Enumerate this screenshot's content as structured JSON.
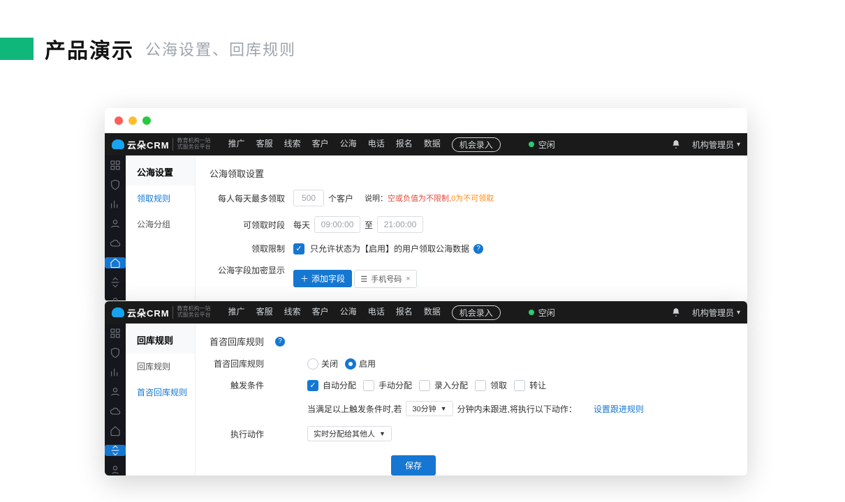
{
  "title": {
    "main": "产品演示",
    "sub": "公海设置、回库规则"
  },
  "topnav": [
    "推广",
    "客服",
    "线索",
    "客户",
    "公海",
    "电话",
    "报名",
    "数据"
  ],
  "topnav_pill": "机会录入",
  "status_text": "空闲",
  "user_name": "机构管理员",
  "logo_text": "云朵CRM",
  "logo_sub": "教育机构一站式服务云平台",
  "win1": {
    "side_title": "公海设置",
    "side_items": [
      "领取规则",
      "公海分组"
    ],
    "content_title": "公海领取设置",
    "row1": {
      "label": "每人每天最多领取",
      "value": "500",
      "unit": "个客户",
      "note_prefix": "说明：",
      "note_red": "空或负值为不限制,",
      "note_orange": "0为不可领取"
    },
    "row2": {
      "label": "可领取时段",
      "prefix": "每天",
      "from": "09:00:00",
      "to_label": "至",
      "to": "21:00:00"
    },
    "row3": {
      "label": "领取限制",
      "text": "只允许状态为【启用】的用户领取公海数据"
    },
    "row4": {
      "label": "公海字段加密显示",
      "btn": "添加字段",
      "tag": "手机号码"
    }
  },
  "win2": {
    "side_title": "回库规则",
    "side_items": [
      "回库规则",
      "首咨回库规则"
    ],
    "content_title": "首咨回库规则",
    "row1": {
      "label": "首咨回库规则",
      "opt_off": "关闭",
      "opt_on": "启用"
    },
    "row2": {
      "label": "触发条件",
      "opts": [
        "自动分配",
        "手动分配",
        "录入分配",
        "领取",
        "转让"
      ]
    },
    "row3": {
      "text_a": "当满足以上触发条件时,若",
      "sel": "30分钟",
      "text_b": "分钟内未跟进,将执行以下动作：",
      "link": "设置跟进规则"
    },
    "row4": {
      "label": "执行动作",
      "sel": "实时分配给其他人"
    },
    "save": "保存"
  }
}
